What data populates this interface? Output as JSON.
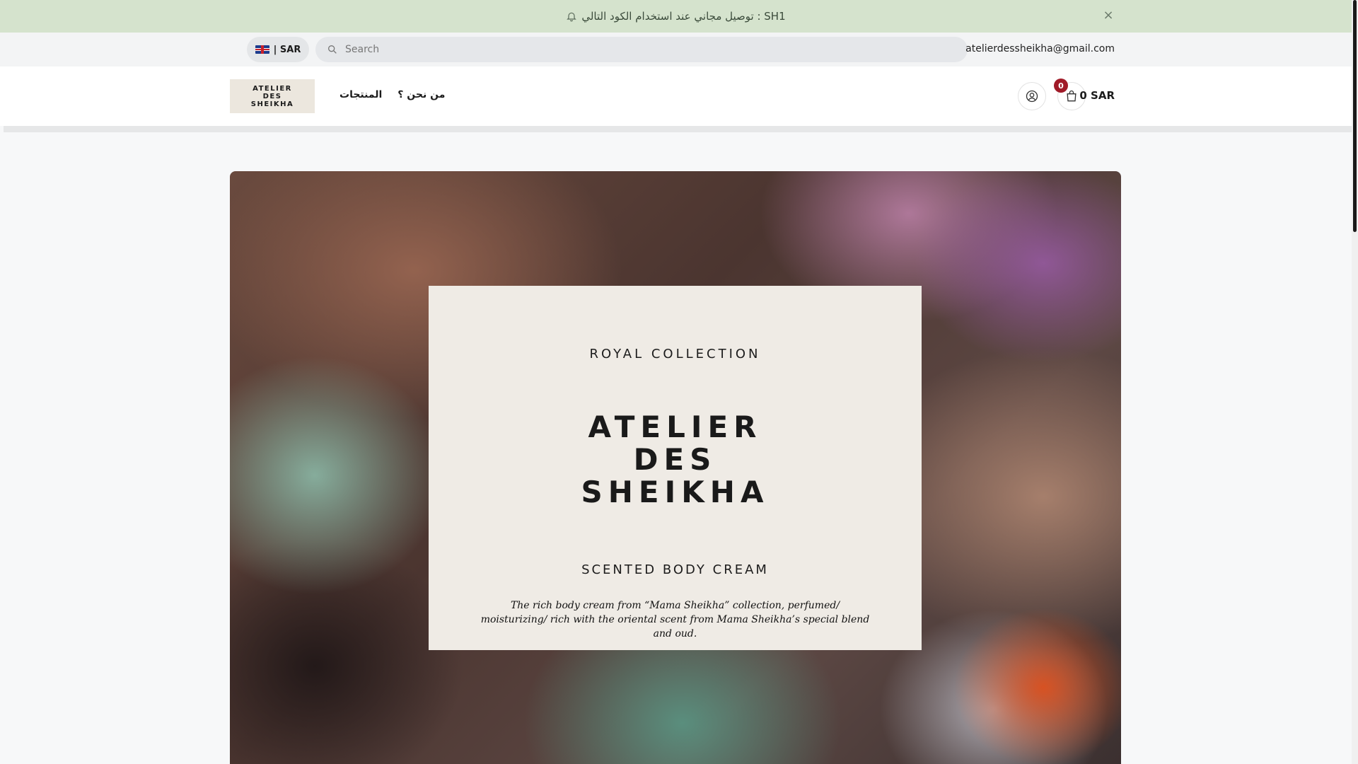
{
  "announcement": {
    "text": "SH1 : توصيل مجاني عند استخدام الكود التالي",
    "close_label": "×"
  },
  "topbar": {
    "currency_label": "| SAR",
    "search_placeholder": "Search",
    "email": "atelierdessheikha@gmail.com"
  },
  "header": {
    "logo_lines": [
      "ATELIER",
      "DES",
      "SHEIKHA"
    ],
    "nav": [
      "المنتجات",
      "من نحن ؟"
    ],
    "cart_count": "0",
    "cart_total": "0 SAR"
  },
  "hero": {
    "eyebrow": "ROYAL COLLECTION",
    "brand_lines": [
      "ATELIER",
      "DES",
      "SHEIKHA"
    ],
    "subtitle": "SCENTED BODY CREAM",
    "description": "The rich body cream from “Mama Sheikha” collection, perfumed/ moisturizing/ rich with the oriental scent from Mama Sheikha’s special blend and oud."
  },
  "colors": {
    "announcement_bg": "#d5e3cd",
    "badge": "#a01a28",
    "card_bg": "#efebe5"
  },
  "icons": [
    "bell-icon",
    "close-icon",
    "uk-flag-icon",
    "search-icon",
    "user-icon",
    "shopping-bag-icon"
  ]
}
